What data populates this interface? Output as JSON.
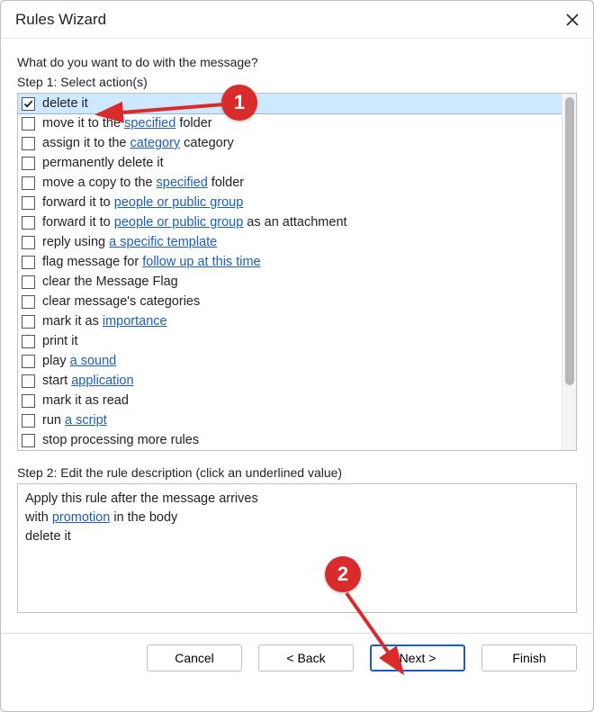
{
  "title": "Rules Wizard",
  "prompt": "What do you want to do with the message?",
  "step1_label": "Step 1: Select action(s)",
  "step2_label": "Step 2: Edit the rule description (click an underlined value)",
  "actions": [
    {
      "checked": true,
      "selected": true,
      "parts": [
        {
          "t": "delete it"
        }
      ]
    },
    {
      "checked": false,
      "selected": false,
      "parts": [
        {
          "t": "move it to the "
        },
        {
          "t": "specified",
          "u": true
        },
        {
          "t": " folder"
        }
      ]
    },
    {
      "checked": false,
      "selected": false,
      "parts": [
        {
          "t": "assign it to the "
        },
        {
          "t": "category",
          "u": true
        },
        {
          "t": " category"
        }
      ]
    },
    {
      "checked": false,
      "selected": false,
      "parts": [
        {
          "t": "permanently delete it"
        }
      ]
    },
    {
      "checked": false,
      "selected": false,
      "parts": [
        {
          "t": "move a copy to the "
        },
        {
          "t": "specified",
          "u": true
        },
        {
          "t": " folder"
        }
      ]
    },
    {
      "checked": false,
      "selected": false,
      "parts": [
        {
          "t": "forward it to "
        },
        {
          "t": "people or public group",
          "u": true
        }
      ]
    },
    {
      "checked": false,
      "selected": false,
      "parts": [
        {
          "t": "forward it to "
        },
        {
          "t": "people or public group",
          "u": true
        },
        {
          "t": " as an attachment"
        }
      ]
    },
    {
      "checked": false,
      "selected": false,
      "parts": [
        {
          "t": "reply using "
        },
        {
          "t": "a specific template",
          "u": true
        }
      ]
    },
    {
      "checked": false,
      "selected": false,
      "parts": [
        {
          "t": "flag message for "
        },
        {
          "t": "follow up at this time",
          "u": true
        }
      ]
    },
    {
      "checked": false,
      "selected": false,
      "parts": [
        {
          "t": "clear the Message Flag"
        }
      ]
    },
    {
      "checked": false,
      "selected": false,
      "parts": [
        {
          "t": "clear message's categories"
        }
      ]
    },
    {
      "checked": false,
      "selected": false,
      "parts": [
        {
          "t": "mark it as "
        },
        {
          "t": "importance",
          "u": true
        }
      ]
    },
    {
      "checked": false,
      "selected": false,
      "parts": [
        {
          "t": "print it"
        }
      ]
    },
    {
      "checked": false,
      "selected": false,
      "parts": [
        {
          "t": "play "
        },
        {
          "t": "a sound",
          "u": true
        }
      ]
    },
    {
      "checked": false,
      "selected": false,
      "parts": [
        {
          "t": "start "
        },
        {
          "t": "application",
          "u": true
        }
      ]
    },
    {
      "checked": false,
      "selected": false,
      "parts": [
        {
          "t": "mark it as read"
        }
      ]
    },
    {
      "checked": false,
      "selected": false,
      "parts": [
        {
          "t": "run "
        },
        {
          "t": "a script",
          "u": true
        }
      ]
    },
    {
      "checked": false,
      "selected": false,
      "parts": [
        {
          "t": "stop processing more rules"
        }
      ]
    }
  ],
  "description": {
    "line1": "Apply this rule after the message arrives",
    "line2_pre": "with ",
    "line2_link": "promotion",
    "line2_post": " in the body",
    "line3": "delete it"
  },
  "buttons": {
    "cancel": "Cancel",
    "back": "< Back",
    "next": "Next >",
    "finish": "Finish"
  },
  "annotations": {
    "badge1": "1",
    "badge2": "2"
  }
}
